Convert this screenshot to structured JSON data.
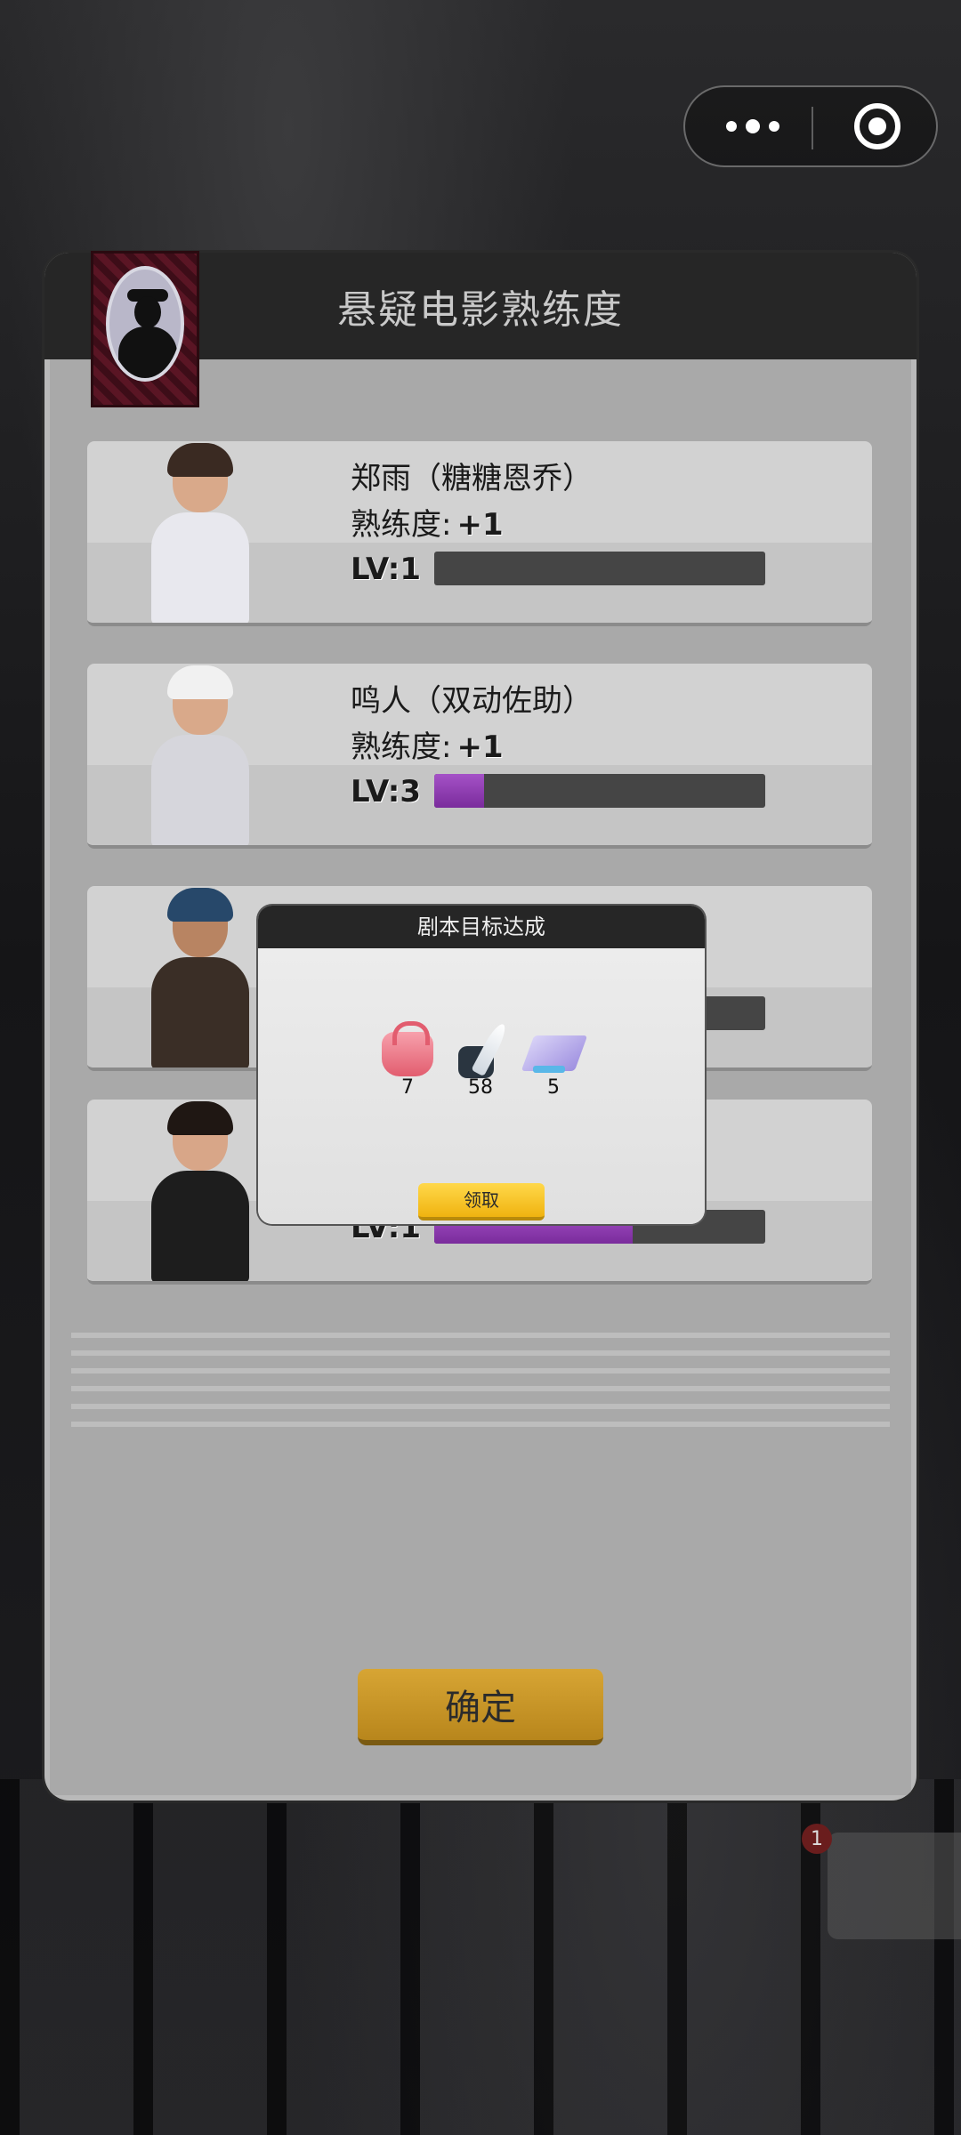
{
  "panel": {
    "title": "悬疑电影熟练度",
    "confirm_label": "确定"
  },
  "prof_label": "熟练度:",
  "characters": [
    {
      "name": "郑雨（糖糖恩乔）",
      "proficiency": "+1",
      "level": "LV:1",
      "progress": 0.0
    },
    {
      "name": "鸣人（双动佐助）",
      "proficiency": "+1",
      "level": "LV:3",
      "progress": 0.15
    },
    {
      "name": "",
      "proficiency": "",
      "level": "",
      "progress": 0.0
    },
    {
      "name": "",
      "proficiency": "",
      "level": "LV:1",
      "progress": 0.6
    }
  ],
  "modal": {
    "title": "剧本目标达成",
    "rewards": [
      {
        "icon": "handbag-icon",
        "count": "7"
      },
      {
        "icon": "ink-quill-icon",
        "count": "58"
      },
      {
        "icon": "book-icon",
        "count": "5"
      }
    ],
    "claim_label": "领取"
  },
  "colors": {
    "progress_purple": "#8e3bb3",
    "button_gold": "#d7a534",
    "claim_yellow": "#ffd84a"
  }
}
